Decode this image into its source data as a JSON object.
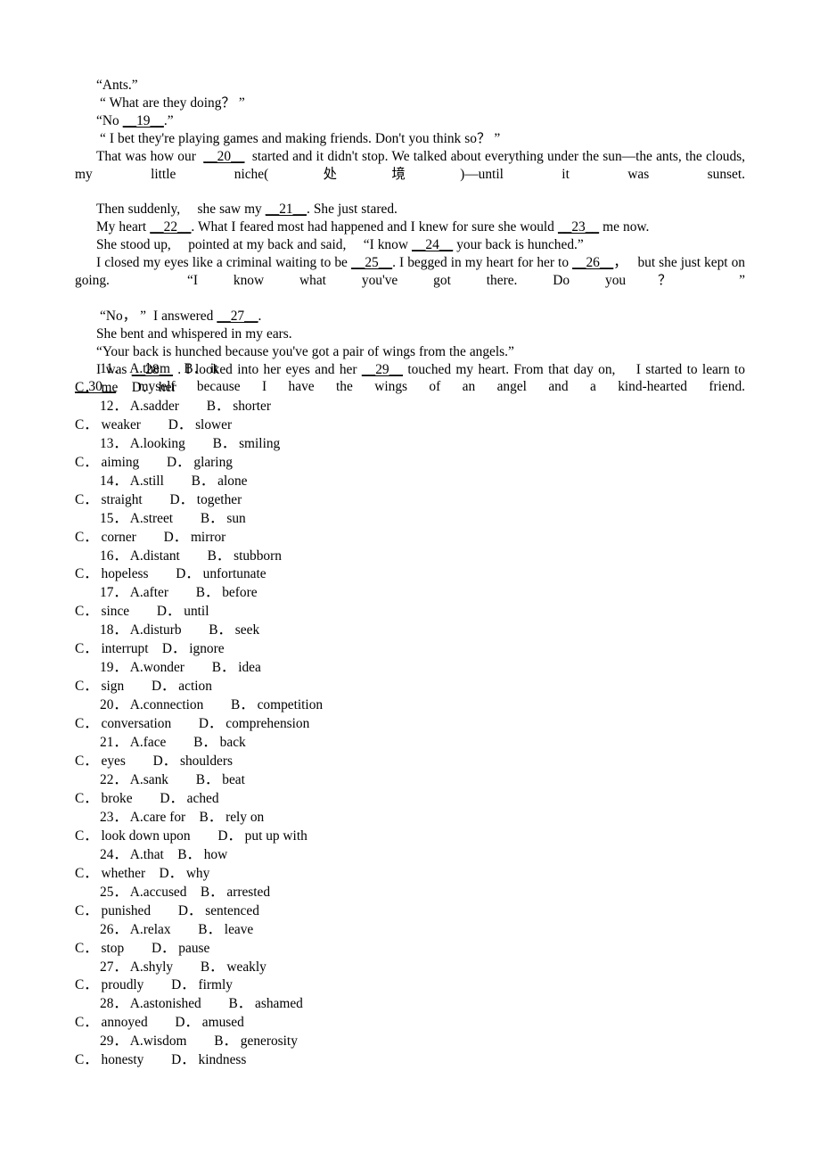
{
  "document": {
    "type": "cloze-test-worksheet",
    "language": "en-with-zh-gloss"
  },
  "passage": {
    "lines": [
      {
        "id": "line-ants",
        "indent": "indent-1",
        "segments": [
          {
            "text": "“Ants.”"
          }
        ]
      },
      {
        "id": "line-what-doing",
        "indent": "indent-2",
        "segments": [
          {
            "text": "“ What are they doing？ ”"
          }
        ]
      },
      {
        "id": "line-no-19",
        "indent": "indent-1",
        "segments": [
          {
            "text": "“No "
          },
          {
            "text": "__19__",
            "blank": true
          },
          {
            "text": ".”"
          }
        ]
      },
      {
        "id": "line-i-bet",
        "indent": "indent-2",
        "segments": [
          {
            "text": "“ I bet they're playing games and making friends. Don't you think so？ ”"
          }
        ]
      },
      {
        "id": "line-that-was-how",
        "indent": "indent-1",
        "justify": true,
        "segments": [
          {
            "text": "That was how our  "
          },
          {
            "text": "__20__",
            "blank": true
          },
          {
            "text": "  started and it didn't stop. We talked about everything under the sun—the ants, the clouds,　 my little niche(处境)—until it was sunset."
          }
        ]
      },
      {
        "id": "line-then-suddenly",
        "indent": "indent-1",
        "segments": [
          {
            "text": "Then suddenly,　 she saw my "
          },
          {
            "text": "__21__",
            "blank": true
          },
          {
            "text": ". She just stared."
          }
        ]
      },
      {
        "id": "line-my-heart",
        "indent": "indent-1",
        "segments": [
          {
            "text": "My heart "
          },
          {
            "text": "__22__",
            "blank": true
          },
          {
            "text": ". What I feared most had happened and I knew for sure she would "
          },
          {
            "text": "__23__",
            "blank": true
          },
          {
            "text": " me now."
          }
        ]
      },
      {
        "id": "line-she-stood-up",
        "indent": "indent-1",
        "segments": [
          {
            "text": "She stood up,　 pointed at my back and said,　 “I know "
          },
          {
            "text": "__24__",
            "blank": true
          },
          {
            "text": " your back is hunched.”"
          }
        ]
      },
      {
        "id": "line-i-closed-my-eyes",
        "indent": "indent-1",
        "justify": true,
        "segments": [
          {
            "text": "I closed my eyes like a criminal waiting to be "
          },
          {
            "text": "__25__",
            "blank": true
          },
          {
            "text": ". I begged in my heart for her to "
          },
          {
            "text": "__26__",
            "blank": true
          },
          {
            "text": "，　 but she just kept on going.　“I know what you've got there. Do you？ ”"
          }
        ]
      },
      {
        "id": "line-no-27",
        "indent": "indent-2",
        "segments": [
          {
            "text": "“No， ”  I answered "
          },
          {
            "text": "__27__",
            "blank": true
          },
          {
            "text": "."
          }
        ]
      },
      {
        "id": "line-she-bent",
        "indent": "indent-1",
        "segments": [
          {
            "text": "She bent and whispered in my ears."
          }
        ]
      },
      {
        "id": "line-your-back",
        "indent": "indent-1",
        "segments": [
          {
            "text": "“Your back is hunched because you've got a pair of wings from the angels.”"
          }
        ]
      },
      {
        "id": "line-i-was-28",
        "indent": "indent-1",
        "justify": true,
        "segments": [
          {
            "text": "I was "
          },
          {
            "text": "__28__",
            "blank": true
          },
          {
            "text": " . I looked into her eyes and her "
          },
          {
            "text": "__29__",
            "blank": true
          },
          {
            "text": " touched my heart. From that day on,　 I started to learn to "
          },
          {
            "text": "__30__",
            "blank": true
          },
          {
            "text": " myself because I have the wings of an angel and a kind-hearted friend."
          }
        ]
      }
    ]
  },
  "questions": [
    {
      "number": "11．",
      "ab": "A.them　B． it",
      "cd": "C． me　D． her",
      "options": {
        "A": "them",
        "B": "it",
        "C": "me",
        "D": "her"
      }
    },
    {
      "number": "12．",
      "ab": "A.sadder　　B． shorter",
      "cd": "C． weaker　　D． slower",
      "options": {
        "A": "sadder",
        "B": "shorter",
        "C": "weaker",
        "D": "slower"
      }
    },
    {
      "number": "13．",
      "ab": "A.looking　　B． smiling",
      "cd": "C． aiming　　D． glaring",
      "options": {
        "A": "looking",
        "B": "smiling",
        "C": "aiming",
        "D": "glaring"
      }
    },
    {
      "number": "14．",
      "ab": "A.still　　B． alone",
      "cd": "C． straight　　D． together",
      "options": {
        "A": "still",
        "B": "alone",
        "C": "straight",
        "D": "together"
      }
    },
    {
      "number": "15．",
      "ab": "A.street　　B． sun",
      "cd": "C． corner　　D． mirror",
      "options": {
        "A": "street",
        "B": "sun",
        "C": "corner",
        "D": "mirror"
      }
    },
    {
      "number": "16．",
      "ab": "A.distant　　B． stubborn",
      "cd": "C． hopeless　　D． unfortunate",
      "options": {
        "A": "distant",
        "B": "stubborn",
        "C": "hopeless",
        "D": "unfortunate"
      }
    },
    {
      "number": "17．",
      "ab": "A.after　　B． before",
      "cd": "C． since　　D． until",
      "options": {
        "A": "after",
        "B": "before",
        "C": "since",
        "D": "until"
      }
    },
    {
      "number": "18．",
      "ab": "A.disturb　　B． seek",
      "cd": "C． interrupt　D． ignore",
      "options": {
        "A": "disturb",
        "B": "seek",
        "C": "interrupt",
        "D": "ignore"
      }
    },
    {
      "number": "19．",
      "ab": "A.wonder　　B． idea",
      "cd": "C． sign　　D． action",
      "options": {
        "A": "wonder",
        "B": "idea",
        "C": "sign",
        "D": "action"
      }
    },
    {
      "number": "20．",
      "ab": "A.connection　　B． competition",
      "cd": "C． conversation　　D． comprehension",
      "options": {
        "A": "connection",
        "B": "competition",
        "C": "conversation",
        "D": "comprehension"
      }
    },
    {
      "number": "21．",
      "ab": "A.face　　B． back",
      "cd": "C． eyes　　D． shoulders",
      "options": {
        "A": "face",
        "B": "back",
        "C": "eyes",
        "D": "shoulders"
      }
    },
    {
      "number": "22．",
      "ab": "A.sank　　B． beat",
      "cd": "C． broke　　D． ached",
      "options": {
        "A": "sank",
        "B": "beat",
        "C": "broke",
        "D": "ached"
      }
    },
    {
      "number": "23．",
      "ab": "A.care for　B． rely on",
      "cd": "C． look down upon　　D． put up with",
      "options": {
        "A": "care for",
        "B": "rely on",
        "C": "look down upon",
        "D": "put up with"
      }
    },
    {
      "number": "24．",
      "ab": "A.that　B． how",
      "cd": "C． whether　D． why",
      "options": {
        "A": "that",
        "B": "how",
        "C": "whether",
        "D": "why"
      }
    },
    {
      "number": "25．",
      "ab": "A.accused　B． arrested",
      "cd": "C． punished　　D． sentenced",
      "options": {
        "A": "accused",
        "B": "arrested",
        "C": "punished",
        "D": "sentenced"
      }
    },
    {
      "number": "26．",
      "ab": "A.relax　　B． leave",
      "cd": "C． stop　　D． pause",
      "options": {
        "A": "relax",
        "B": "leave",
        "C": "stop",
        "D": "pause"
      }
    },
    {
      "number": "27．",
      "ab": "A.shyly　　B． weakly",
      "cd": "C． proudly　　D． firmly",
      "options": {
        "A": "shyly",
        "B": "weakly",
        "C": "proudly",
        "D": "firmly"
      }
    },
    {
      "number": "28．",
      "ab": "A.astonished　　B． ashamed",
      "cd": "C． annoyed　　D． amused",
      "options": {
        "A": "astonished",
        "B": "ashamed",
        "C": "annoyed",
        "D": "amused"
      }
    },
    {
      "number": "29．",
      "ab": "A.wisdom　　B． generosity",
      "cd": "C． honesty　　D． kindness",
      "options": {
        "A": "wisdom",
        "B": "generosity",
        "C": "honesty",
        "D": "kindness"
      }
    }
  ]
}
